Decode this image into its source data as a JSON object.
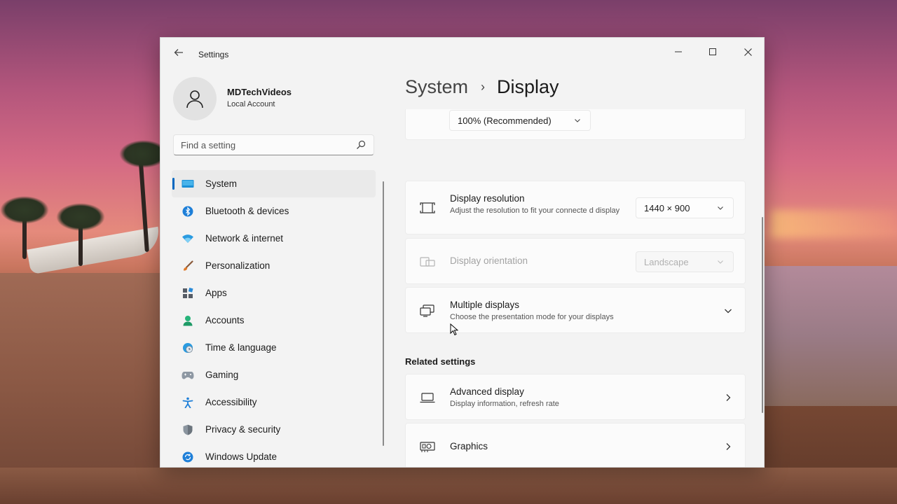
{
  "window": {
    "app_title": "Settings"
  },
  "profile": {
    "name": "MDTechVideos",
    "account_type": "Local Account"
  },
  "search": {
    "placeholder": "Find a setting"
  },
  "sidebar": {
    "items": [
      {
        "label": "System",
        "icon": "system-icon",
        "active": true
      },
      {
        "label": "Bluetooth & devices",
        "icon": "bluetooth-icon"
      },
      {
        "label": "Network & internet",
        "icon": "wifi-icon"
      },
      {
        "label": "Personalization",
        "icon": "brush-icon"
      },
      {
        "label": "Apps",
        "icon": "apps-icon"
      },
      {
        "label": "Accounts",
        "icon": "account-icon"
      },
      {
        "label": "Time & language",
        "icon": "globe-clock-icon"
      },
      {
        "label": "Gaming",
        "icon": "gamepad-icon"
      },
      {
        "label": "Accessibility",
        "icon": "accessibility-icon"
      },
      {
        "label": "Privacy & security",
        "icon": "shield-icon"
      },
      {
        "label": "Windows Update",
        "icon": "update-icon"
      }
    ]
  },
  "breadcrumb": {
    "parent": "System",
    "separator": "›",
    "current": "Display"
  },
  "settings": {
    "scale": {
      "value": "100% (Recommended)"
    },
    "resolution": {
      "title": "Display resolution",
      "description": "Adjust the resolution to fit your connecte d display",
      "value": "1440 × 900"
    },
    "orientation": {
      "title": "Display orientation",
      "value": "Landscape",
      "disabled": true
    },
    "multiple_displays": {
      "title": "Multiple displays",
      "description": "Choose the presentation mode for your displays"
    }
  },
  "related": {
    "header": "Related settings",
    "advanced_display": {
      "title": "Advanced display",
      "description": "Display information, refresh rate"
    },
    "graphics": {
      "title": "Graphics"
    }
  },
  "colors": {
    "accent": "#0067c0",
    "window_bg": "#f3f3f3",
    "card_bg": "#fbfbfb"
  }
}
